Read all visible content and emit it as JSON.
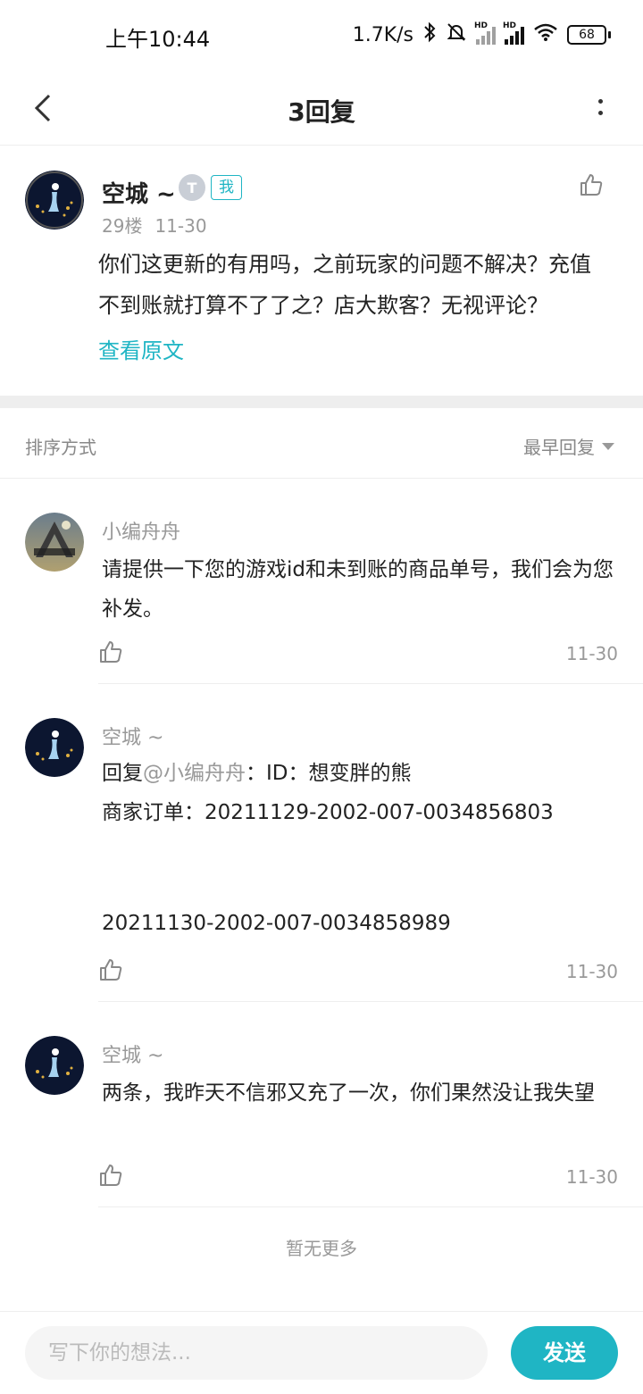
{
  "status": {
    "time": "上午10:44",
    "net_speed": "1.7K/s",
    "battery": "68",
    "hd_label": "HD"
  },
  "header": {
    "title": "3回复"
  },
  "main_post": {
    "author": "空城 ~",
    "level_badge": "T",
    "me_badge": "我",
    "floor": "29楼",
    "date": "11-30",
    "text": "你们这更新的有用吗，之前玩家的问题不解决？充值不到账就打算不了了之？店大欺客？无视评论？",
    "view_original": "查看原文"
  },
  "sort": {
    "label": "排序方式",
    "value": "最早回复"
  },
  "replies": [
    {
      "name": "小编舟舟",
      "text": "请提供一下您的游戏id和未到账的商品单号，我们会为您补发。",
      "date": "11-30"
    },
    {
      "name": "空城 ~",
      "reply_prefix": "回复",
      "mention": "@小编舟舟",
      "line1_rest": "：ID：想变胖的熊",
      "line2": "商家订单：20211129-2002-007-0034856803",
      "line3": "20211130-2002-007-0034858989",
      "date": "11-30"
    },
    {
      "name": "空城 ~",
      "text": "两条，我昨天不信邪又充了一次，你们果然没让我失望",
      "date": "11-30"
    }
  ],
  "footer_note": "暂无更多",
  "composer": {
    "placeholder": "写下你的想法...",
    "send_label": "发送"
  }
}
